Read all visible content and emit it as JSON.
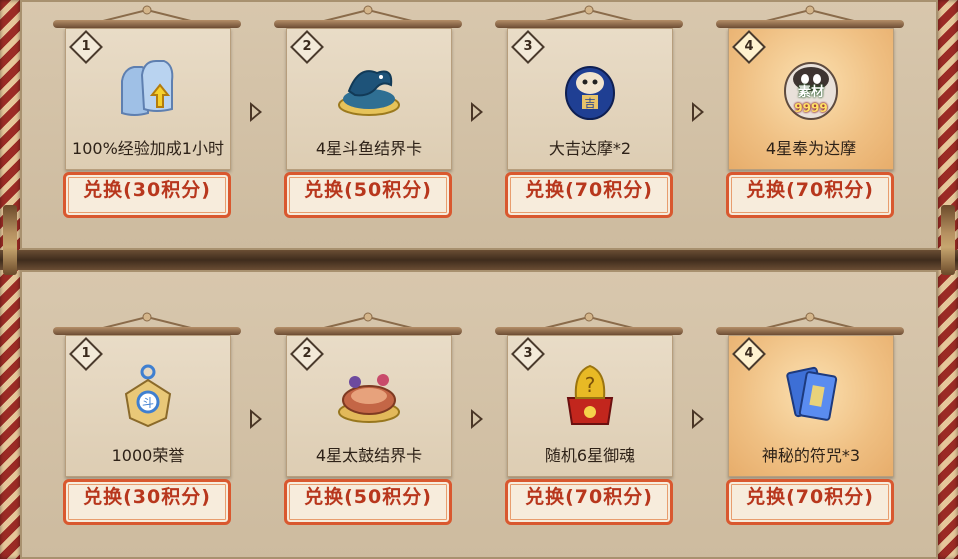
{
  "rows": [
    {
      "cards": [
        {
          "tier": "1",
          "name": "100%经验加成1小时",
          "button": "兑换(30积分)",
          "icon": "exp-boost-bags-icon",
          "highlight": false
        },
        {
          "tier": "2",
          "name": "4星斗鱼结界卡",
          "button": "兑换(50积分)",
          "icon": "fighting-fish-barrier-card-icon",
          "highlight": false
        },
        {
          "tier": "3",
          "name": "大吉达摩*2",
          "button": "兑换(70积分)",
          "icon": "daruma-doll-icon",
          "highlight": false
        },
        {
          "tier": "4",
          "name": "4星奉为达摩",
          "button": "兑换(70积分)",
          "icon": "offering-daruma-icon",
          "highlight": true,
          "icon_text": "素材",
          "icon_count": "9999"
        }
      ]
    },
    {
      "cards": [
        {
          "tier": "1",
          "name": "1000荣誉",
          "button": "兑换(30积分)",
          "icon": "honor-token-icon",
          "highlight": false
        },
        {
          "tier": "2",
          "name": "4星太鼓结界卡",
          "button": "兑换(50积分)",
          "icon": "taiko-drum-barrier-card-icon",
          "highlight": false
        },
        {
          "tier": "3",
          "name": "随机6星御魂",
          "button": "兑换(70积分)",
          "icon": "mystery-soul-bag-icon",
          "highlight": false
        },
        {
          "tier": "4",
          "name": "神秘的符咒*3",
          "button": "兑换(70积分)",
          "icon": "mystery-talisman-icon",
          "highlight": true
        }
      ]
    }
  ],
  "colors": {
    "button_text": "#b8371d",
    "button_border": "#d9582f",
    "highlight_bg": "#efbf82",
    "panel_bg": "#d8c7ad"
  }
}
